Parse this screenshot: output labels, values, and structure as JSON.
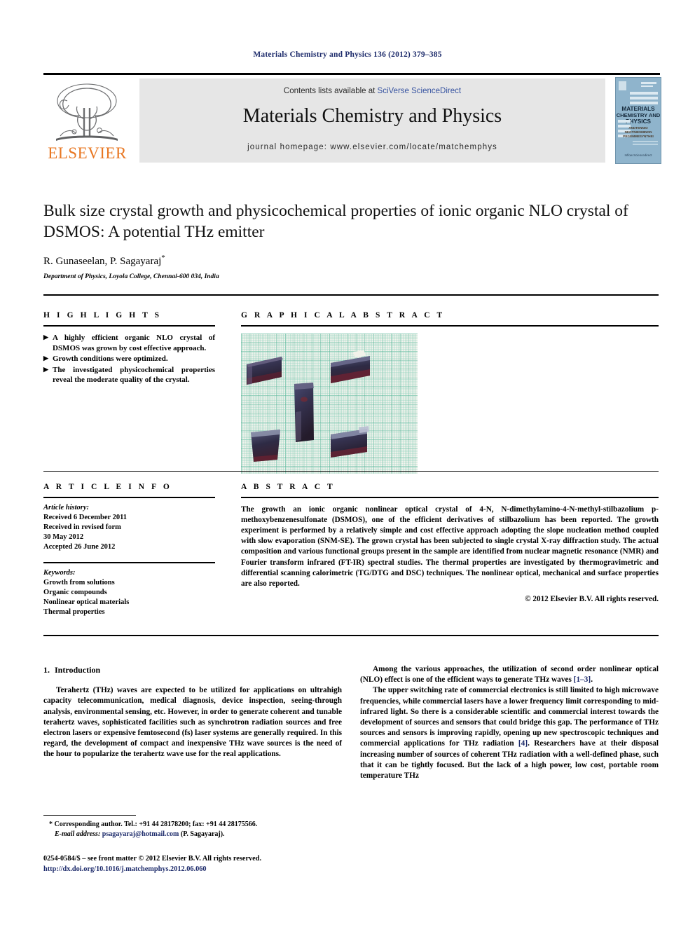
{
  "running_head": "Materials Chemistry and Physics 136 (2012) 379–385",
  "masthead": {
    "contents_prefix": "Contents lists available at ",
    "contents_link": "SciVerse ScienceDirect",
    "journal_name": "Materials Chemistry and Physics",
    "homepage": "journal homepage: www.elsevier.com/locate/matchemphys",
    "publisher_logo_text": "ELSEVIER",
    "cover": {
      "line1": "MATERIALS",
      "line2": "CHEMISTRY AND",
      "line3": "PHYSICS",
      "sub1": "ANDTENNIO",
      "sub2": "NEGTNIESMINON",
      "sub3": "PRGEMMESYNTHEI",
      "footer": "Inflow Sciencedirect"
    },
    "colors": {
      "link_blue": "#3552a0",
      "elsevier_orange": "#E87722",
      "band_grey": "#e6e6e6",
      "cover_blue": "#8fb4cc"
    }
  },
  "article": {
    "title": "Bulk size crystal growth and physicochemical properties of ionic organic NLO crystal of DSMOS: A potential THz emitter",
    "authors": "R. Gunaseelan, P. Sagayaraj",
    "corresponding_marker": "*",
    "affiliation": "Department of Physics, Loyola College, Chennai-600 034, India"
  },
  "highlights": {
    "heading": "H I G H L I G H T S",
    "items": [
      "A highly efficient organic NLO crystal of DSMOS was grown by cost effective approach.",
      "Growth conditions were optimized.",
      "The investigated physicochemical properties reveal the moderate quality of the crystal."
    ],
    "bullet_glyph": "▶"
  },
  "graphical_abstract": {
    "heading": "G R A P H I C A L   A B S T R A C T",
    "image_description": "photograph of four dark violet DSMOS crystals on green millimetre graph paper"
  },
  "article_info": {
    "heading": "A R T I C L E   I N F O",
    "history_label": "Article history:",
    "history": [
      "Received 6 December 2011",
      "Received in revised form",
      "30 May 2012",
      "Accepted 26 June 2012"
    ],
    "keywords_label": "Keywords:",
    "keywords": [
      "Growth from solutions",
      "Organic compounds",
      "Nonlinear optical materials",
      "Thermal properties"
    ]
  },
  "abstract": {
    "heading": "A B S T R A C T",
    "text": "The growth an ionic organic nonlinear optical crystal of 4-N, N-dimethylamino-4-N-methyl-stilbazolium p-methoxybenzenesulfonate (DSMOS), one of the efficient derivatives of stilbazolium has been reported. The growth experiment is performed by a relatively simple and cost effective approach adopting the slope nucleation method coupled with slow evaporation (SNM-SE). The grown crystal has been subjected to single crystal X-ray diffraction study. The actual composition and various functional groups present in the sample are identified from nuclear magnetic resonance (NMR) and Fourier transform infrared (FT-IR) spectral studies. The thermal properties are investigated by thermogravimetric and differential scanning calorimetric (TG/DTG and DSC) techniques. The nonlinear optical, mechanical and surface properties are also reported.",
    "copyright": "© 2012 Elsevier B.V. All rights reserved."
  },
  "body": {
    "section_number": "1.",
    "section_title": "Introduction",
    "left_paragraph": "Terahertz (THz) waves are expected to be utilized for applications on ultrahigh capacity telecommunication, medical diagnosis, device inspection, seeing-through analysis, environmental sensing, etc. However, in order to generate coherent and tunable terahertz waves, sophisticated facilities such as synchrotron radiation sources and free electron lasers or expensive femtosecond (fs) laser systems are generally required. In this regard, the development of compact and inexpensive THz wave sources is the need of the hour to popularize the terahertz wave use for the real applications.",
    "right_paragraph_1_a": "Among the various approaches, the utilization of second order nonlinear optical (NLO) effect is one of the efficient ways to generate THz waves ",
    "right_paragraph_1_ref": "[1–3]",
    "right_paragraph_1_b": ".",
    "right_paragraph_2_a": "The upper switching rate of commercial electronics is still limited to high microwave frequencies, while commercial lasers have a lower frequency limit corresponding to mid-infrared light. So there is a considerable scientific and commercial interest towards the development of sources and sensors that could bridge this gap. The performance of THz sources and sensors is improving rapidly, opening up new spectroscopic techniques and commercial applications for THz radiation ",
    "right_paragraph_2_ref": "[4]",
    "right_paragraph_2_b": ". Researchers have at their disposal increasing number of sources of coherent THz radiation with a well-defined phase, such that it can be tightly focused. But the lack of a high power, low cost, portable room temperature THz"
  },
  "footnote": {
    "marker": "*",
    "corresponding": "Corresponding author. Tel.: +91 44 28178200; fax: +91 44 28175566.",
    "email_label": "E-mail address:",
    "email": "psagayaraj@hotmail.com",
    "email_suffix": "(P. Sagayaraj)."
  },
  "footer": {
    "issn_line": "0254-0584/$ – see front matter © 2012 Elsevier B.V. All rights reserved.",
    "doi": "http://dx.doi.org/10.1016/j.matchemphys.2012.06.060"
  }
}
